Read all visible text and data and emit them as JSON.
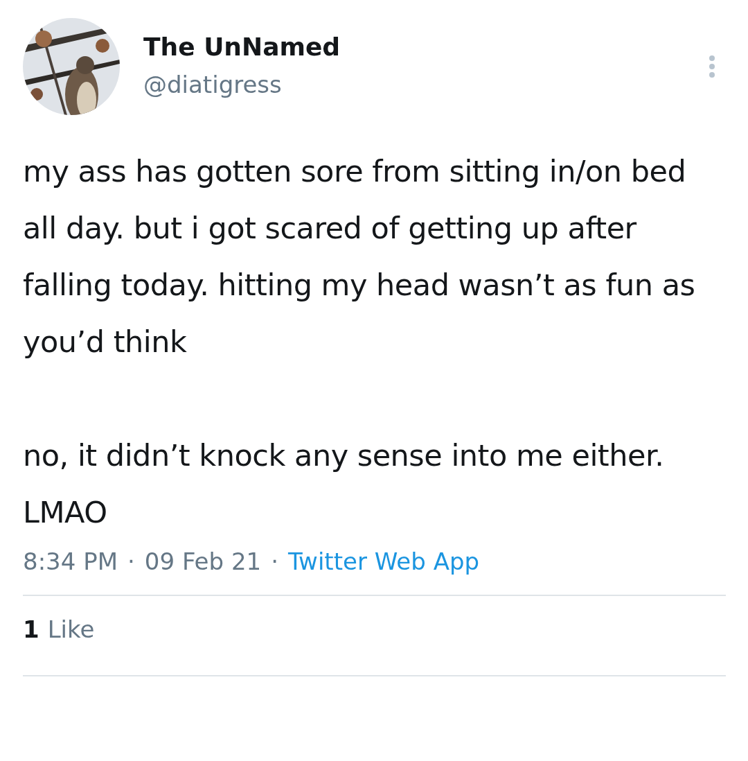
{
  "author": {
    "name": "The UnNamed",
    "handle": "@diatigress"
  },
  "body": [
    "my ass has gotten sore from sitting in/on bed all day. but i got scared of getting up after falling today. hitting my head wasn’t as fun as you’d think",
    "no, it didn’t knock any sense into me either. LMAO"
  ],
  "meta": [
    {
      "kind": "time",
      "text": "8:34 PM"
    },
    {
      "kind": "separator",
      "text": "·"
    },
    {
      "kind": "date",
      "text": "09 Feb 21"
    },
    {
      "kind": "separator",
      "text": "·"
    },
    {
      "kind": "source",
      "text": "Twitter Web App"
    }
  ],
  "stats": {
    "count": "1",
    "label": "Like"
  }
}
